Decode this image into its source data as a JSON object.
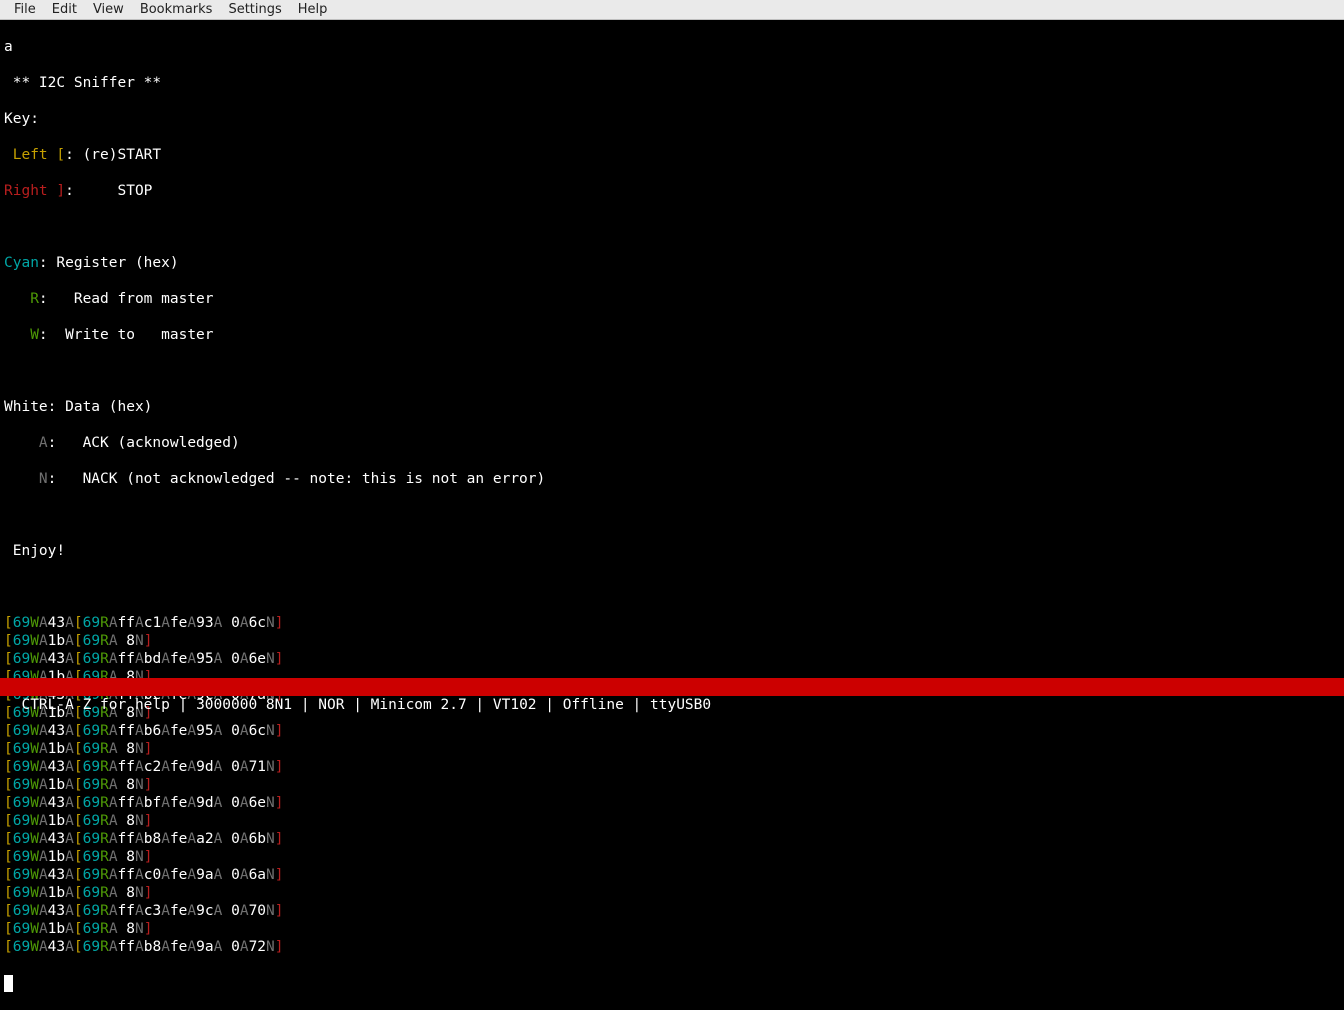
{
  "menubar": {
    "items": [
      "File",
      "Edit",
      "View",
      "Bookmarks",
      "Settings",
      "Help"
    ]
  },
  "intro": {
    "first_line": "a",
    "title": " ** I2C Sniffer **",
    "key_heading": "Key:",
    "left_label": " Left [",
    "left_desc": ": (re)START",
    "right_label": "Right ]",
    "right_desc": ":     STOP",
    "cyan_label": "Cyan",
    "cyan_desc": ": Register (hex)",
    "r_label": "   R",
    "r_desc": ":   Read from master",
    "w_label": "   W",
    "w_desc": ":  Write to   master",
    "white_label": "White",
    "white_desc": ": Data (hex)",
    "a_label": "    A",
    "a_desc": ":   ACK (acknowledged)",
    "n_label": "    N",
    "n_desc": ":   NACK (not acknowledged -- note: this is not an error)",
    "enjoy": " Enjoy!"
  },
  "sniff_lines": [
    {
      "reg": "69",
      "rw": "W",
      "ack1": "A",
      "d1": "43",
      "a1": "A",
      "reg2": "69",
      "rw2": "R",
      "ack2": "A",
      "payload": "ffAc1AfeA93A 0A6c",
      "endack": "N"
    },
    {
      "reg": "69",
      "rw": "W",
      "ack1": "A",
      "d1": "1b",
      "a1": "A",
      "reg2": "69",
      "rw2": "R",
      "ack2": "A",
      "payload": " 8",
      "endack": "N"
    },
    {
      "reg": "69",
      "rw": "W",
      "ack1": "A",
      "d1": "43",
      "a1": "A",
      "reg2": "69",
      "rw2": "R",
      "ack2": "A",
      "payload": "ffAbdAfeA95A 0A6e",
      "endack": "N"
    },
    {
      "reg": "69",
      "rw": "W",
      "ack1": "A",
      "d1": "1b",
      "a1": "A",
      "reg2": "69",
      "rw2": "R",
      "ack2": "A",
      "payload": " 8",
      "endack": "N"
    },
    {
      "reg": "69",
      "rw": "W",
      "ack1": "A",
      "d1": "43",
      "a1": "A",
      "reg2": "69",
      "rw2": "R",
      "ack2": "A",
      "payload": "ffAbcAfeA9cA 0A7a",
      "endack": "N"
    },
    {
      "reg": "69",
      "rw": "W",
      "ack1": "A",
      "d1": "1b",
      "a1": "A",
      "reg2": "69",
      "rw2": "R",
      "ack2": "A",
      "payload": " 8",
      "endack": "N"
    },
    {
      "reg": "69",
      "rw": "W",
      "ack1": "A",
      "d1": "43",
      "a1": "A",
      "reg2": "69",
      "rw2": "R",
      "ack2": "A",
      "payload": "ffAb6AfeA95A 0A6c",
      "endack": "N"
    },
    {
      "reg": "69",
      "rw": "W",
      "ack1": "A",
      "d1": "1b",
      "a1": "A",
      "reg2": "69",
      "rw2": "R",
      "ack2": "A",
      "payload": " 8",
      "endack": "N"
    },
    {
      "reg": "69",
      "rw": "W",
      "ack1": "A",
      "d1": "43",
      "a1": "A",
      "reg2": "69",
      "rw2": "R",
      "ack2": "A",
      "payload": "ffAc2AfeA9dA 0A71",
      "endack": "N"
    },
    {
      "reg": "69",
      "rw": "W",
      "ack1": "A",
      "d1": "1b",
      "a1": "A",
      "reg2": "69",
      "rw2": "R",
      "ack2": "A",
      "payload": " 8",
      "endack": "N"
    },
    {
      "reg": "69",
      "rw": "W",
      "ack1": "A",
      "d1": "43",
      "a1": "A",
      "reg2": "69",
      "rw2": "R",
      "ack2": "A",
      "payload": "ffAbfAfeA9dA 0A6e",
      "endack": "N"
    },
    {
      "reg": "69",
      "rw": "W",
      "ack1": "A",
      "d1": "1b",
      "a1": "A",
      "reg2": "69",
      "rw2": "R",
      "ack2": "A",
      "payload": " 8",
      "endack": "N"
    },
    {
      "reg": "69",
      "rw": "W",
      "ack1": "A",
      "d1": "43",
      "a1": "A",
      "reg2": "69",
      "rw2": "R",
      "ack2": "A",
      "payload": "ffAb8AfeAa2A 0A6b",
      "endack": "N"
    },
    {
      "reg": "69",
      "rw": "W",
      "ack1": "A",
      "d1": "1b",
      "a1": "A",
      "reg2": "69",
      "rw2": "R",
      "ack2": "A",
      "payload": " 8",
      "endack": "N"
    },
    {
      "reg": "69",
      "rw": "W",
      "ack1": "A",
      "d1": "43",
      "a1": "A",
      "reg2": "69",
      "rw2": "R",
      "ack2": "A",
      "payload": "ffAc0AfeA9aA 0A6a",
      "endack": "N"
    },
    {
      "reg": "69",
      "rw": "W",
      "ack1": "A",
      "d1": "1b",
      "a1": "A",
      "reg2": "69",
      "rw2": "R",
      "ack2": "A",
      "payload": " 8",
      "endack": "N"
    },
    {
      "reg": "69",
      "rw": "W",
      "ack1": "A",
      "d1": "43",
      "a1": "A",
      "reg2": "69",
      "rw2": "R",
      "ack2": "A",
      "payload": "ffAc3AfeA9cA 0A70",
      "endack": "N"
    },
    {
      "reg": "69",
      "rw": "W",
      "ack1": "A",
      "d1": "1b",
      "a1": "A",
      "reg2": "69",
      "rw2": "R",
      "ack2": "A",
      "payload": " 8",
      "endack": "N"
    },
    {
      "reg": "69",
      "rw": "W",
      "ack1": "A",
      "d1": "43",
      "a1": "A",
      "reg2": "69",
      "rw2": "R",
      "ack2": "A",
      "payload": "ffAb8AfeA9aA 0A72",
      "endack": "N"
    }
  ],
  "statusbar": {
    "text": "CTRL-A Z for help | 3000000 8N1 | NOR | Minicom 2.7 | VT102 | Offline | ttyUSB0"
  },
  "brackets": {
    "open": "[",
    "close": "]"
  }
}
